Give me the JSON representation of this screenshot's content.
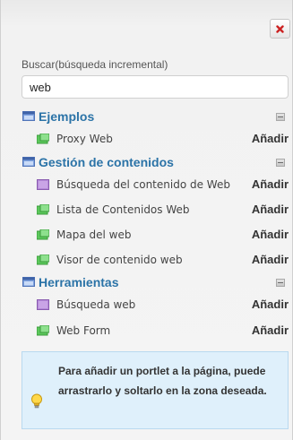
{
  "panel": {
    "close_icon": "close-icon",
    "search": {
      "label": "Buscar(búsqueda incremental)",
      "value": "web"
    },
    "add_label": "Añadir",
    "categories": [
      {
        "label": "Ejemplos",
        "portlets": [
          {
            "label": "Proxy Web",
            "icon": "green-portlet-icon"
          }
        ]
      },
      {
        "label": "Gestión de contenidos",
        "portlets": [
          {
            "label": "Búsqueda del contenido de Web",
            "icon": "purple-portlet-icon"
          },
          {
            "label": "Lista de Contenidos Web",
            "icon": "green-portlet-icon"
          },
          {
            "label": "Mapa del web",
            "icon": "green-portlet-icon"
          },
          {
            "label": "Visor de contenido web",
            "icon": "green-portlet-icon"
          }
        ]
      },
      {
        "label": "Herramientas",
        "portlets": [
          {
            "label": "Búsqueda web",
            "icon": "purple-portlet-icon"
          },
          {
            "label": "Web Form",
            "icon": "green-portlet-icon"
          }
        ]
      }
    ],
    "info": {
      "text": "Para añadir un portlet a la página, puede arrastrarlo y soltarlo en la zona deseada.",
      "icon": "lightbulb-icon"
    }
  },
  "colors": {
    "category_text": "#2b73a7",
    "close_red": "#cc2222",
    "info_background": "#dff0fb"
  }
}
